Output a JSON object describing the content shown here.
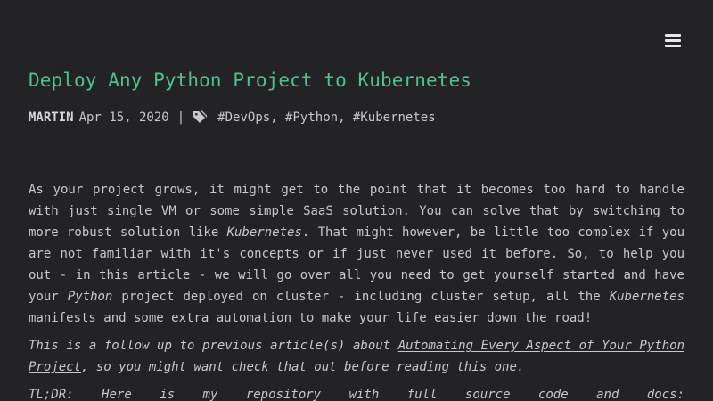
{
  "nav": {
    "menu_icon": "hamburger-menu-icon"
  },
  "post": {
    "title": "Deploy Any Python Project to Kubernetes",
    "author": "MARTIN",
    "date": "Apr 15, 2020",
    "separator": "|",
    "tag_icon": "tag-icon",
    "tags": [
      "#DevOps",
      "#Python",
      "#Kubernetes"
    ],
    "intro": {
      "p1": "As your project grows, it might get to the point that it becomes too hard to handle with just single VM or some simple SaaS solution. You can solve that by switching to more robust solution like ",
      "em1": "Kubernetes",
      "p2": ". That might however, be little too complex if you are not familiar with it's concepts or if just never used it before. So, to help you out - in this article - we will go over all you need to get yourself started and have your ",
      "em2": "Python",
      "p3": " project deployed on cluster - including cluster setup, all the ",
      "em3": "Kubernetes",
      "p4": " manifests and some extra automation to make your life easier down the road!"
    },
    "note": {
      "before": "This is a follow up to previous article(s) about ",
      "link": "Automating Every Aspect of Your Python Project",
      "after": ", so you might want check that out before reading this one."
    },
    "tldr": [
      "TL;DR:",
      "Here",
      "is",
      "my",
      "repository",
      "with",
      "full",
      "source",
      "code",
      "and",
      "docs:"
    ]
  }
}
